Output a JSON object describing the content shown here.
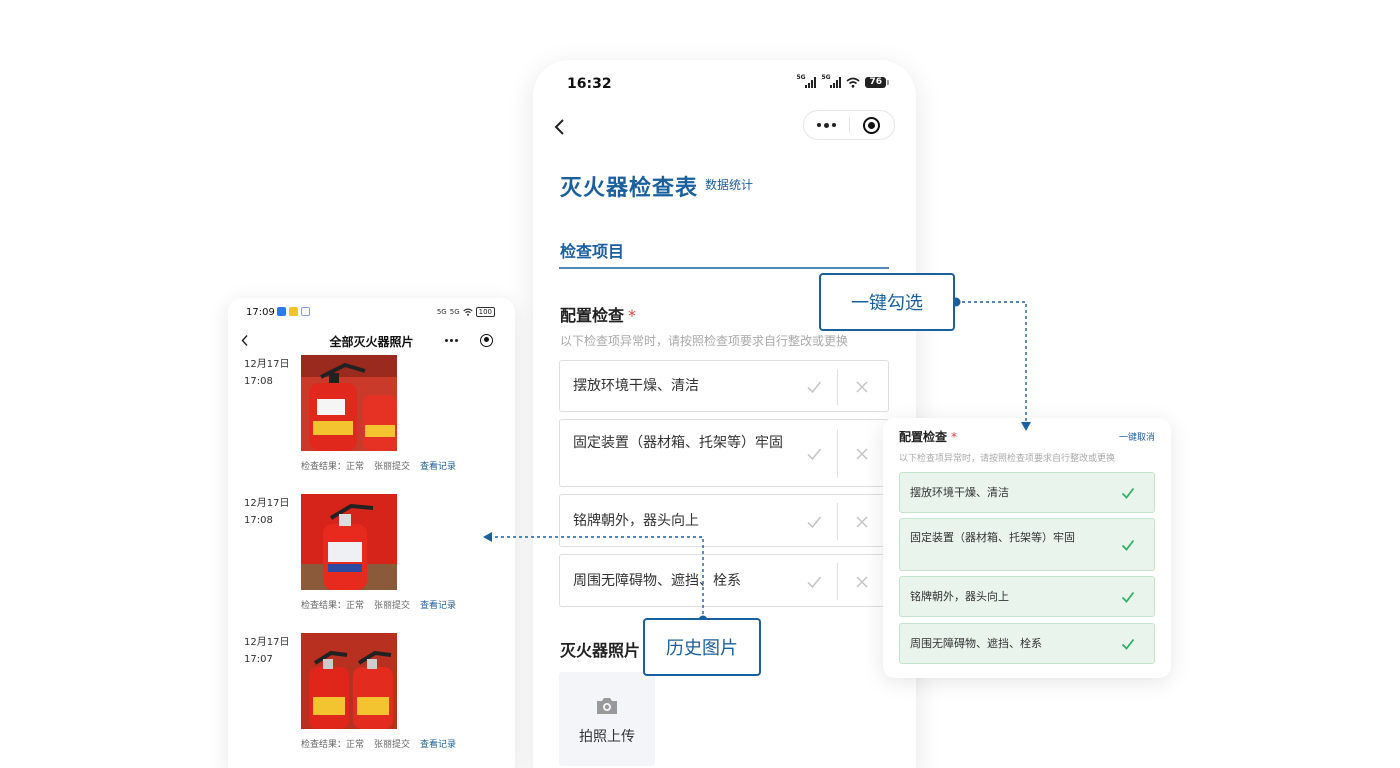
{
  "main_phone": {
    "status_time": "16:32",
    "network_label_1": "5G",
    "network_label_2": "5G",
    "battery": "76",
    "title": "灭火器检查表",
    "subtitle": "数据统计",
    "section_tab": "检查项目",
    "config_title": "配置检查",
    "required_mark": "*",
    "config_hint": "以下检查项异常时，请按照检查项要求自行整改或更换",
    "check_items": [
      {
        "label": "摆放环境干燥、清洁"
      },
      {
        "label": "固定装置（器材箱、托架等）牢固"
      },
      {
        "label": "铭牌朝外，器头向上"
      },
      {
        "label": "周围无障碍物、遮挡、栓系"
      }
    ],
    "photo_title": "灭火器照片",
    "upload_label": "拍照上传",
    "icons": [
      "back-icon",
      "more-dots-icon",
      "close-target-icon",
      "check-icon",
      "cross-icon",
      "camera-icon"
    ]
  },
  "left_phone": {
    "status_time": "17:09",
    "network_label_1": "5G",
    "network_label_2": "5G",
    "battery": "100",
    "title": "全部灭火器照片",
    "records": [
      {
        "date": "12月17日",
        "time": "17:08",
        "result": "检查结果：正常",
        "submitter": "张丽提交",
        "link": "查看记录"
      },
      {
        "date": "12月17日",
        "time": "17:08",
        "result": "检查结果：正常",
        "submitter": "张丽提交",
        "link": "查看记录"
      },
      {
        "date": "12月17日",
        "time": "17:07",
        "result": "检查结果：正常",
        "submitter": "张丽提交",
        "link": "查看记录"
      }
    ]
  },
  "right_card": {
    "title": "配置检查",
    "required_mark": "*",
    "cancel_label": "一键取消",
    "hint": "以下检查项异常时，请按照检查项要求自行整改或更换",
    "items": [
      {
        "label": "摆放环境干燥、清洁"
      },
      {
        "label": "固定装置（器材箱、托架等）牢固"
      },
      {
        "label": "铭牌朝外，器头向上"
      },
      {
        "label": "周围无障碍物、遮挡、栓系"
      }
    ]
  },
  "callouts": {
    "select_all": "一键勾选",
    "history_photos": "历史图片"
  },
  "colors": {
    "brand_blue": "#1a5f9e",
    "check_green": "#2fb065",
    "checked_bg": "#e9f5ec",
    "required_red": "#e04040"
  }
}
